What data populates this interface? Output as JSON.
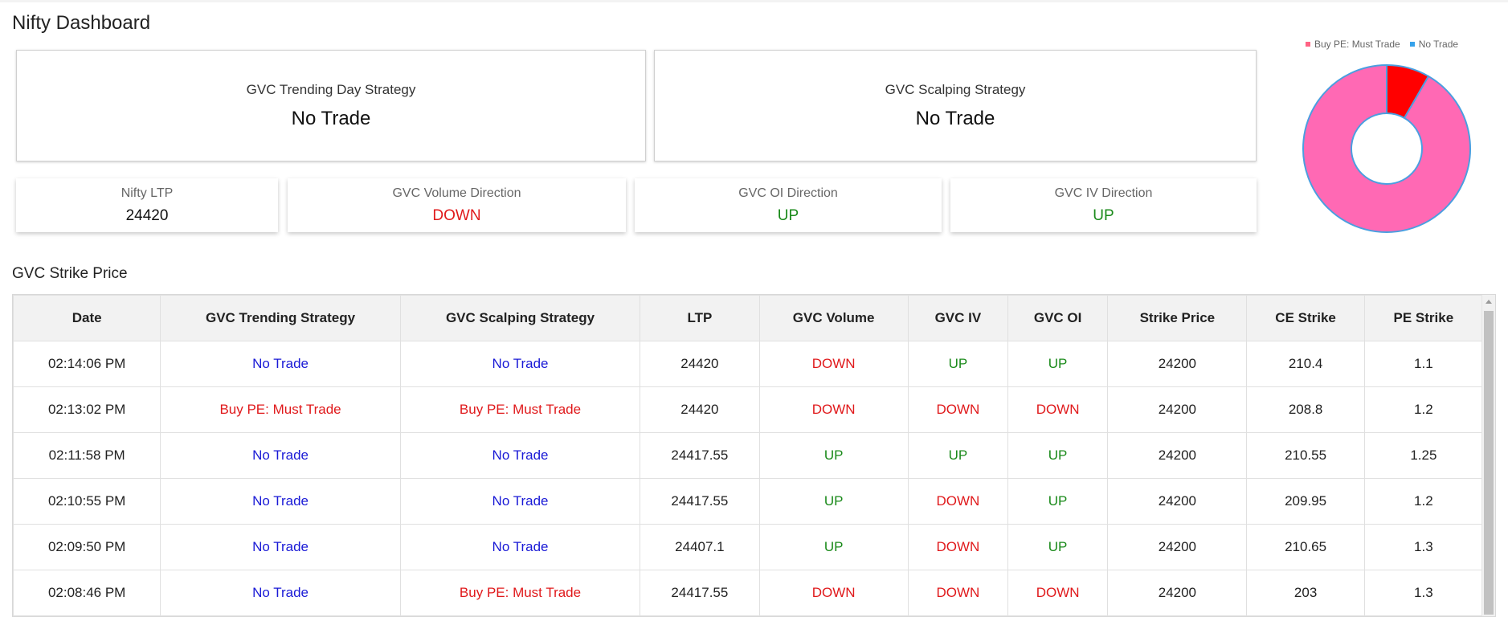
{
  "page": {
    "title": "Nifty Dashboard"
  },
  "strategy_cards": {
    "trending": {
      "title": "GVC Trending Day Strategy",
      "value": "No Trade"
    },
    "scalping": {
      "title": "GVC Scalping Strategy",
      "value": "No Trade"
    }
  },
  "metrics": {
    "ltp": {
      "title": "Nifty LTP",
      "value": "24420"
    },
    "volume": {
      "title": "GVC Volume Direction",
      "value": "DOWN"
    },
    "oi": {
      "title": "GVC OI Direction",
      "value": "UP"
    },
    "iv": {
      "title": "GVC IV Direction",
      "value": "UP"
    }
  },
  "colors": {
    "no_trade": "#1a1ad6",
    "buy": "#e0191b",
    "down": "#e0191b",
    "up": "#1a8a1a",
    "pie_buy_slice": "#ff0000",
    "pie_no_trade_slice": "#ff69b4",
    "pie_outline": "#4a9fe0",
    "legend_buy": "#ff6384",
    "legend_no_trade": "#36a2eb"
  },
  "chart_data": {
    "type": "pie",
    "donut": true,
    "legend_placement": "top",
    "labels": [
      "Buy PE: Must Trade",
      "No Trade"
    ],
    "values": [
      1,
      11
    ]
  },
  "strike_table": {
    "title": "GVC Strike Price",
    "columns": [
      "Date",
      "GVC Trending Strategy",
      "GVC Scalping Strategy",
      "LTP",
      "GVC Volume",
      "GVC IV",
      "GVC OI",
      "Strike Price",
      "CE Strike",
      "PE Strike"
    ],
    "rows": [
      [
        "02:14:06 PM",
        "No Trade",
        "No Trade",
        "24420",
        "DOWN",
        "UP",
        "UP",
        "24200",
        "210.4",
        "1.1"
      ],
      [
        "02:13:02 PM",
        "Buy PE: Must Trade",
        "Buy PE: Must Trade",
        "24420",
        "DOWN",
        "DOWN",
        "DOWN",
        "24200",
        "208.8",
        "1.2"
      ],
      [
        "02:11:58 PM",
        "No Trade",
        "No Trade",
        "24417.55",
        "UP",
        "UP",
        "UP",
        "24200",
        "210.55",
        "1.25"
      ],
      [
        "02:10:55 PM",
        "No Trade",
        "No Trade",
        "24417.55",
        "UP",
        "DOWN",
        "UP",
        "24200",
        "209.95",
        "1.2"
      ],
      [
        "02:09:50 PM",
        "No Trade",
        "No Trade",
        "24407.1",
        "UP",
        "DOWN",
        "UP",
        "24200",
        "210.65",
        "1.3"
      ],
      [
        "02:08:46 PM",
        "No Trade",
        "Buy PE: Must Trade",
        "24417.55",
        "DOWN",
        "DOWN",
        "DOWN",
        "24200",
        "203",
        "1.3"
      ]
    ]
  }
}
